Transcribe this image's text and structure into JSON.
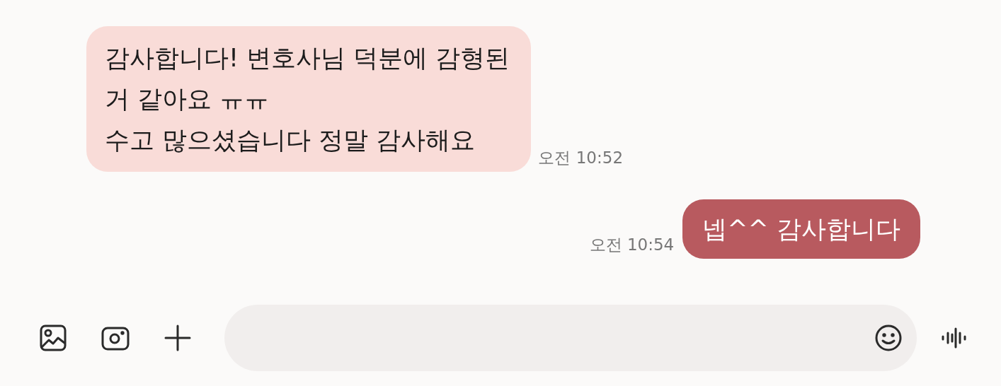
{
  "messages": [
    {
      "kind": "received",
      "text": "감사합니다! 변호사님 덕분에 감형된\n거 같아요 ㅠㅠ\n수고 많으셨습니다 정말 감사해요",
      "time": "오전 10:52"
    },
    {
      "kind": "sent",
      "text": "넵^^ 감사합니다",
      "time": "오전 10:54"
    }
  ]
}
